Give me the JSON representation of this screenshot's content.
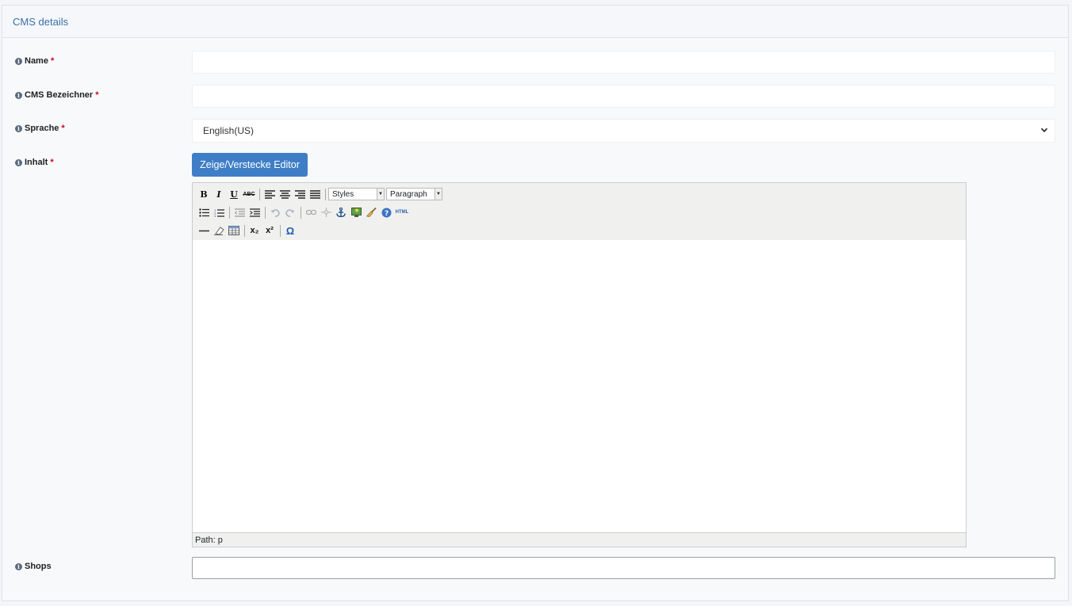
{
  "panel": {
    "title": "CMS details"
  },
  "fields": {
    "name": {
      "label": "Name",
      "required": "*",
      "value": ""
    },
    "cms_identifier": {
      "label": "CMS Bezeichner",
      "required": "*",
      "value": ""
    },
    "language": {
      "label": "Sprache",
      "required": "*",
      "selected": "English(US)"
    },
    "content": {
      "label": "Inhalt",
      "required": "*",
      "toggle_label": "Zeige/Verstecke Editor"
    },
    "shops": {
      "label": "Shops",
      "value": ""
    }
  },
  "editor": {
    "styles_select": "Styles",
    "format_select": "Paragraph",
    "path": "Path: p",
    "html_button": "HTML",
    "bold": "B",
    "italic": "I",
    "underline": "U",
    "strike": "ABC",
    "subscript": "x₂",
    "superscript": "x²",
    "omega": "Ω"
  }
}
